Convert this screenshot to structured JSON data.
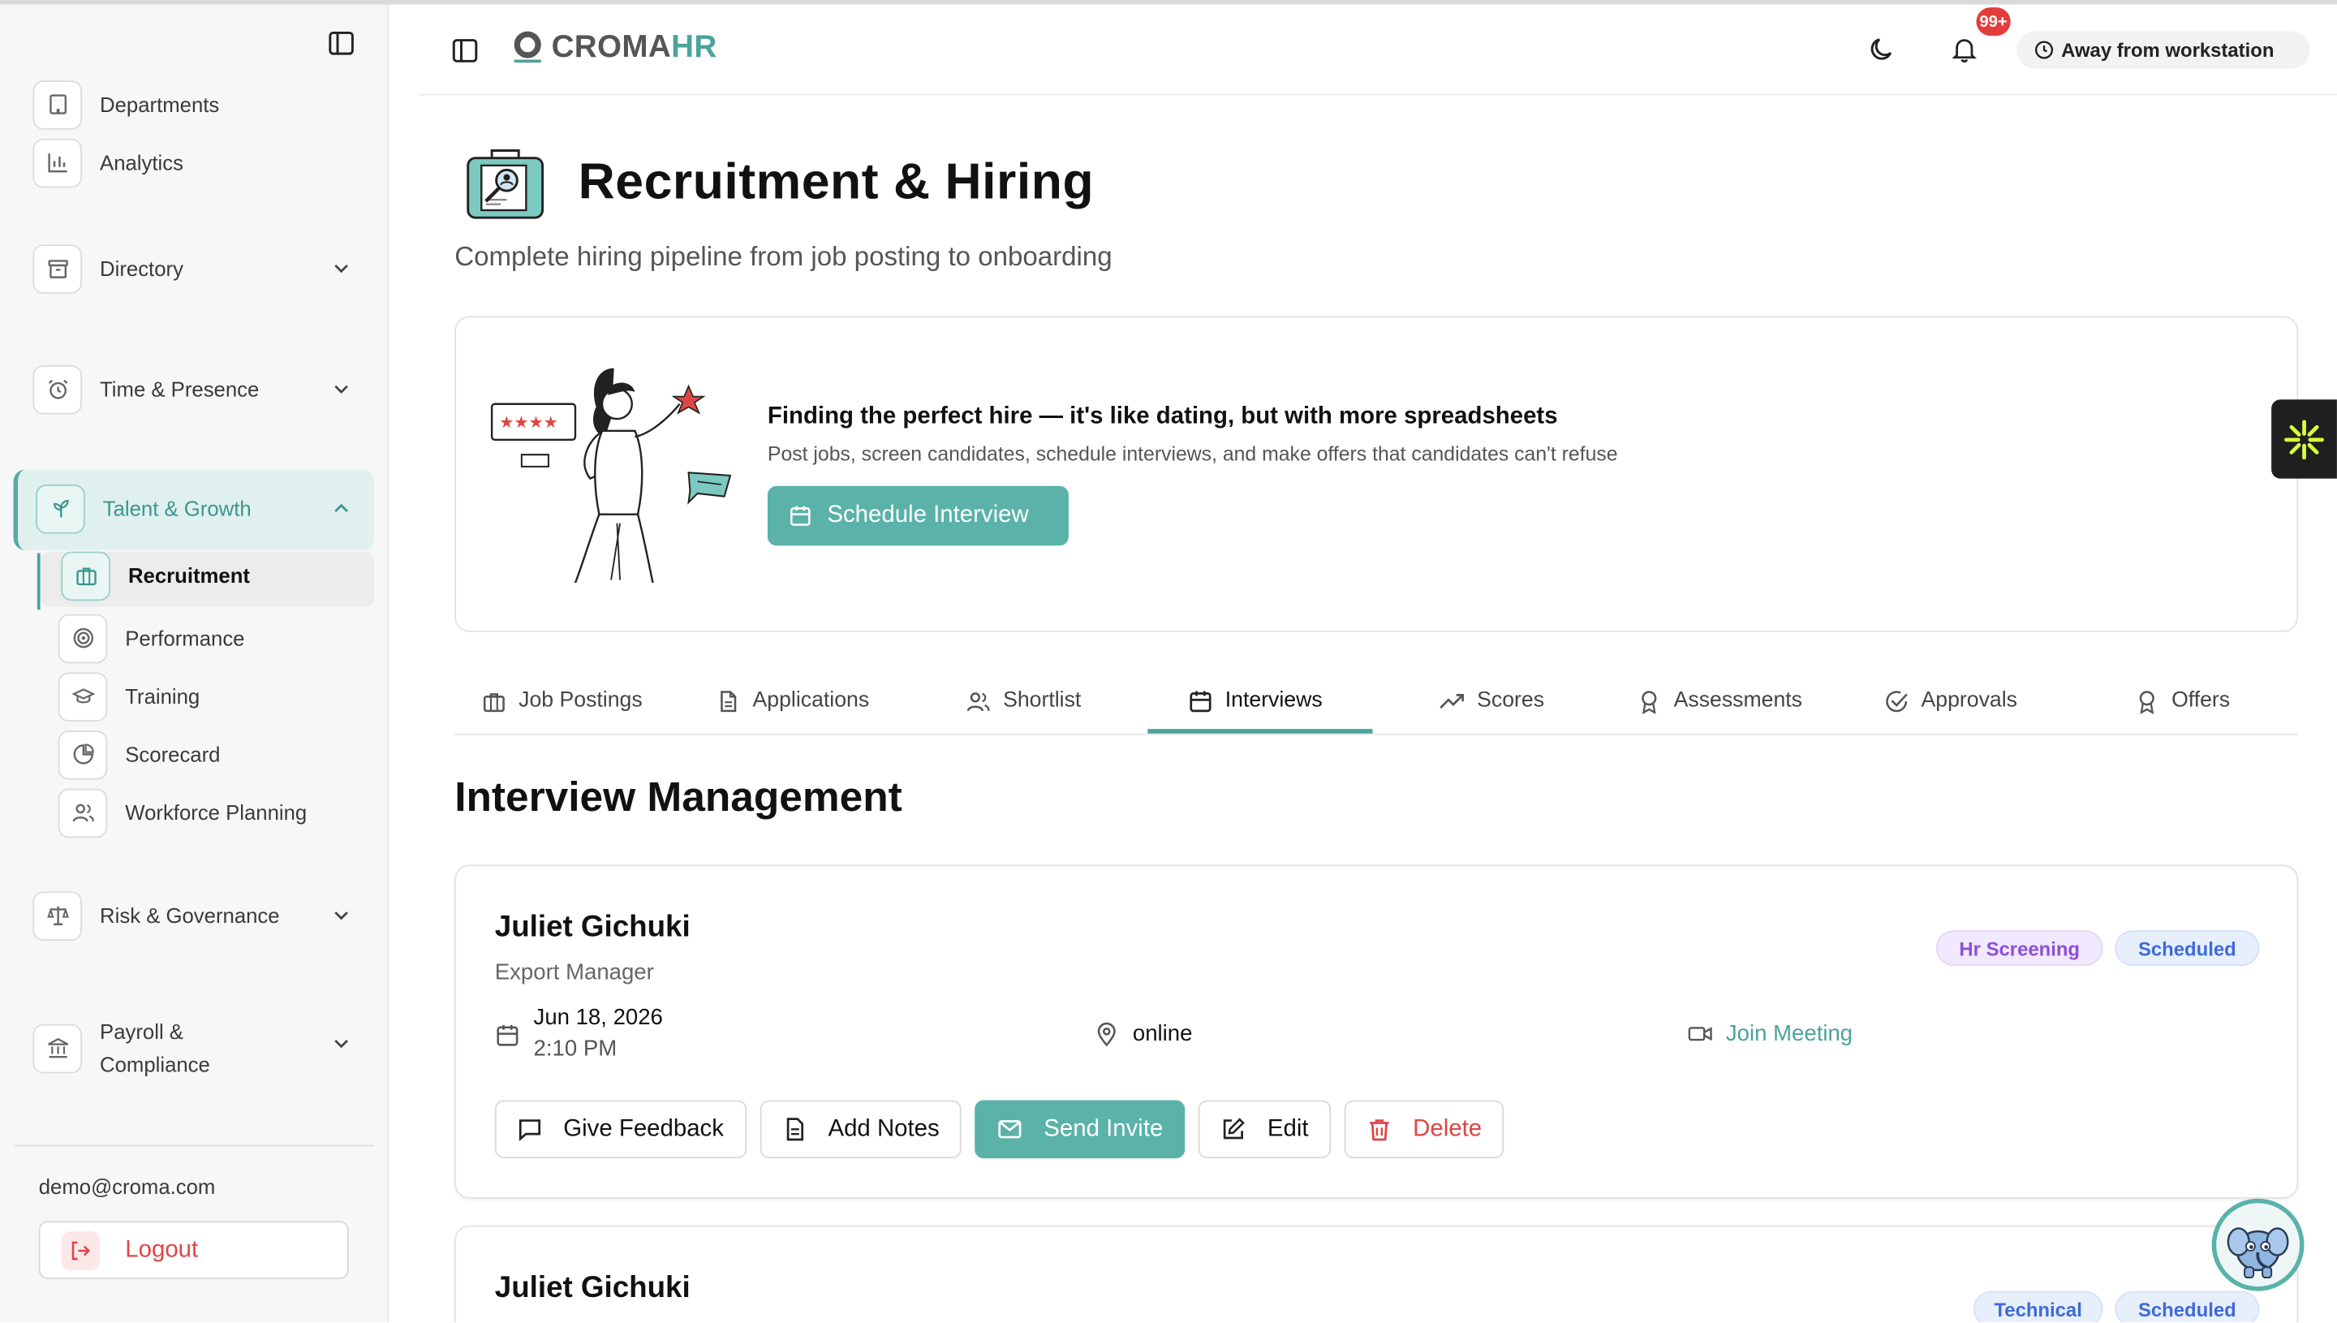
{
  "app": {
    "logo_part1": "CROMA",
    "logo_part2": "HR",
    "notification_count": "99+",
    "status": "Away from workstation"
  },
  "sidebar": {
    "items": [
      {
        "label": "Departments",
        "icon": "building-icon"
      },
      {
        "label": "Analytics",
        "icon": "bar-chart-icon"
      },
      {
        "label": "Directory",
        "icon": "archive-icon",
        "expandable": true
      },
      {
        "label": "Time & Presence",
        "icon": "alarm-clock-icon",
        "expandable": true
      },
      {
        "label": "Talent & Growth",
        "icon": "sprout-icon",
        "expandable": true,
        "expanded": true
      },
      {
        "label": "Risk & Governance",
        "icon": "scale-icon",
        "expandable": true
      },
      {
        "label": "Payroll & Compliance",
        "icon": "bank-icon",
        "expandable": true
      }
    ],
    "sub_items": [
      {
        "label": "Recruitment",
        "icon": "briefcase-icon",
        "active": true
      },
      {
        "label": "Performance",
        "icon": "target-icon"
      },
      {
        "label": "Training",
        "icon": "graduation-cap-icon"
      },
      {
        "label": "Scorecard",
        "icon": "pie-chart-icon"
      },
      {
        "label": "Workforce Planning",
        "icon": "users-icon"
      }
    ],
    "user_email": "demo@croma.com",
    "logout_label": "Logout"
  },
  "page": {
    "title": "Recruitment & Hiring",
    "subtitle": "Complete hiring pipeline from job posting to onboarding"
  },
  "hero": {
    "title": "Finding the perfect hire — it's like dating, but with more spreadsheets",
    "subtitle": "Post jobs, screen candidates, schedule interviews, and make offers that candidates can't refuse",
    "button_label": "Schedule Interview"
  },
  "tabs": [
    {
      "label": "Job Postings",
      "icon": "briefcase-icon"
    },
    {
      "label": "Applications",
      "icon": "file-icon"
    },
    {
      "label": "Shortlist",
      "icon": "users-icon"
    },
    {
      "label": "Interviews",
      "icon": "calendar-icon",
      "active": true
    },
    {
      "label": "Scores",
      "icon": "trending-up-icon"
    },
    {
      "label": "Assessments",
      "icon": "award-icon"
    },
    {
      "label": "Approvals",
      "icon": "check-circle-icon"
    },
    {
      "label": "Offers",
      "icon": "award-icon"
    }
  ],
  "section_title": "Interview Management",
  "interviews": [
    {
      "name": "Juliet Gichuki",
      "role": "Export Manager",
      "tags": [
        "Hr Screening",
        "Scheduled"
      ],
      "date": "Jun 18, 2026",
      "time": "2:10 PM",
      "location": "online",
      "meeting_link_label": "Join Meeting",
      "actions": [
        "Give Feedback",
        "Add Notes",
        "Send Invite",
        "Edit",
        "Delete"
      ]
    },
    {
      "name": "Juliet Gichuki",
      "tags": [
        "Technical",
        "Scheduled"
      ]
    }
  ],
  "colors": {
    "accent": "#5ab2a9",
    "accent_dark": "#4ba39b",
    "danger": "#e04545",
    "notification": "#e43b3b"
  }
}
